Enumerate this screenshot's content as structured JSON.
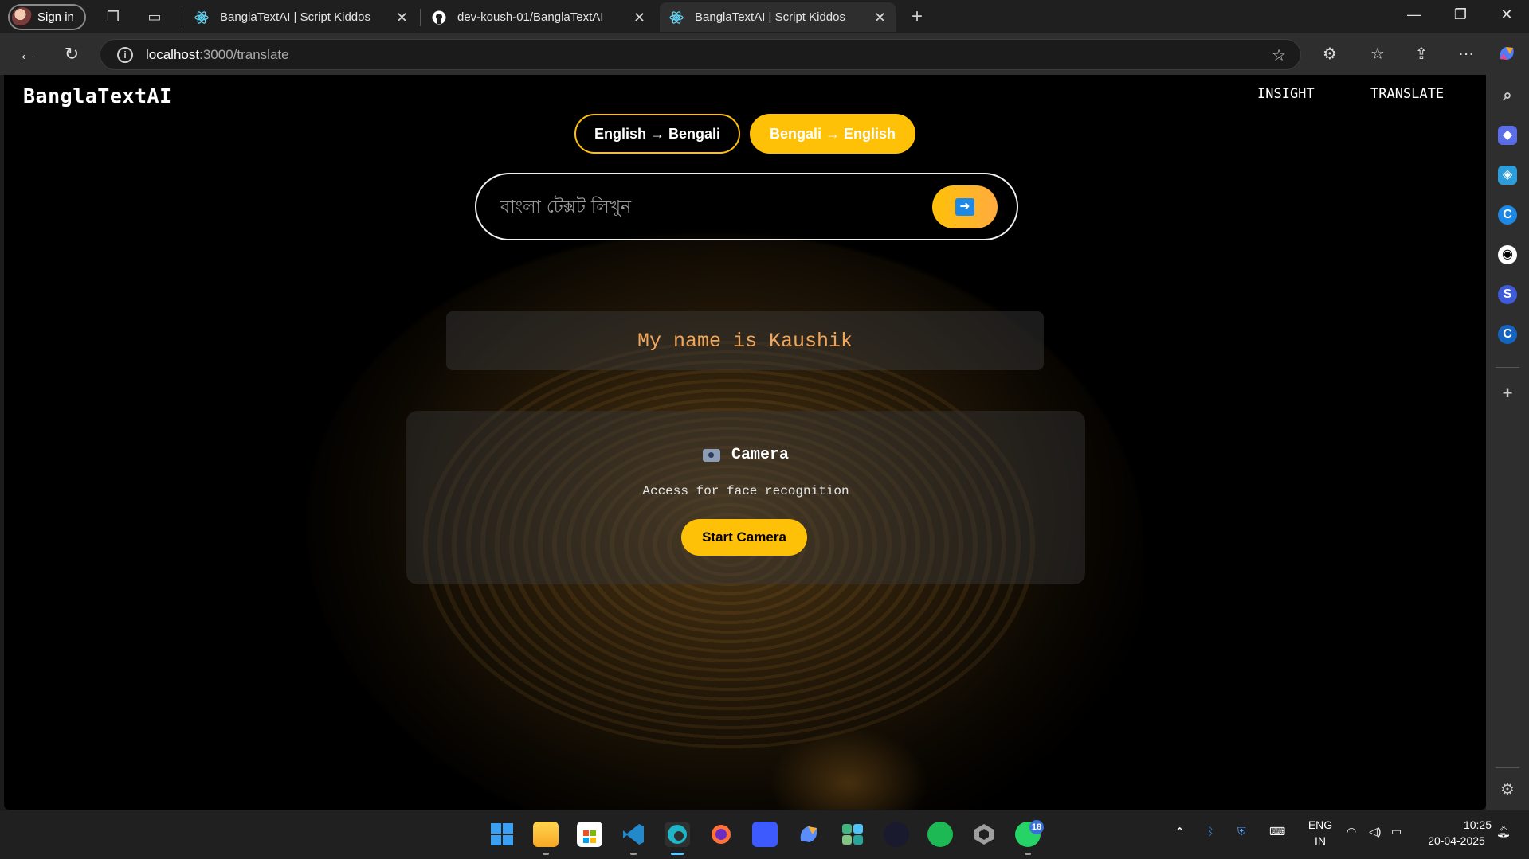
{
  "browser": {
    "signin_label": "Sign in",
    "tabs": [
      {
        "title": "BanglaTextAI | Script Kiddos"
      },
      {
        "title": "dev-koush-01/BanglaTextAI"
      },
      {
        "title": "BanglaTextAI | Script Kiddos"
      }
    ],
    "url_host": "localhost",
    "url_path": ":3000/translate"
  },
  "app": {
    "logo": "BanglaTextAI",
    "nav": [
      "INSIGHT",
      "TRANSLATE"
    ],
    "mode_buttons": [
      "English → Bengali",
      "Bengali → English"
    ],
    "input_placeholder": "বাংলা টেক্সট লিখুন",
    "translation_result": "My name is Kaushik",
    "camera": {
      "title": "Camera",
      "subtitle": "Access for face recognition",
      "button": "Start Camera"
    }
  },
  "taskbar": {
    "lang_line1": "ENG",
    "lang_line2": "IN",
    "time": "10:25",
    "date": "20-04-2025",
    "whatsapp_badge": "18"
  },
  "colors": {
    "accent": "#ffc107",
    "result_text": "#f2a65a",
    "page_bg": "#000000"
  }
}
